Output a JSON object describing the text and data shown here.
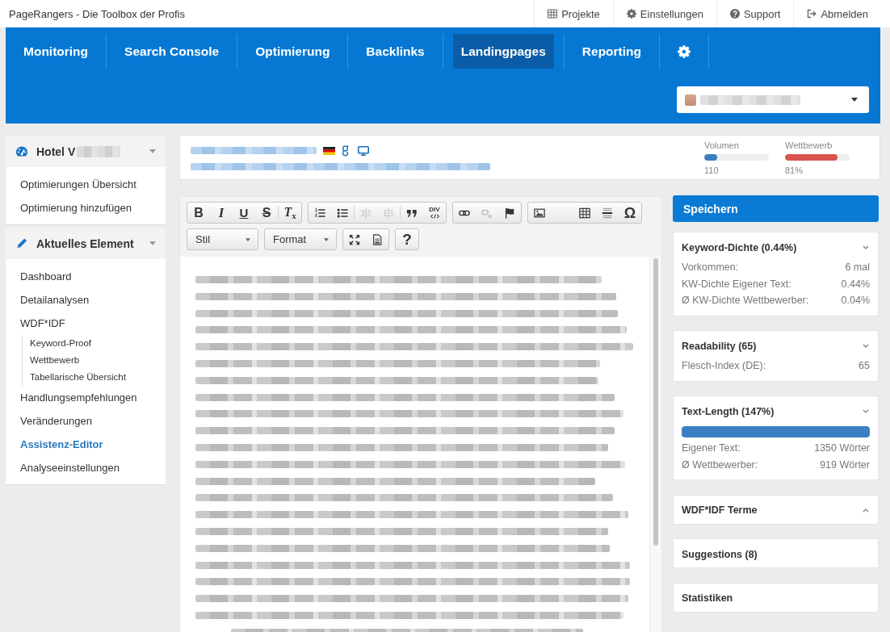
{
  "app": {
    "title": "PageRangers - Die Toolbox der Profis"
  },
  "top_links": [
    {
      "label": "Projekte"
    },
    {
      "label": "Einstellungen"
    },
    {
      "label": "Support"
    },
    {
      "label": "Abmelden"
    }
  ],
  "main_nav": {
    "tabs": [
      {
        "label": "Monitoring",
        "selected": false
      },
      {
        "label": "Search Console",
        "selected": false
      },
      {
        "label": "Optimierung",
        "selected": false
      },
      {
        "label": "Backlinks",
        "selected": false
      },
      {
        "label": "Landingpages",
        "selected": true
      },
      {
        "label": "Reporting",
        "selected": false
      }
    ],
    "settings_tab": {
      "selected": false
    }
  },
  "sidebar": {
    "panels": [
      {
        "title": "Hotel V",
        "items": [
          {
            "label": "Optimierungen Übersicht",
            "selected": false
          },
          {
            "label": "Optimierung hinzufügen",
            "selected": false
          }
        ]
      },
      {
        "title": "Aktuelles Element",
        "items": [
          {
            "label": "Dashboard",
            "selected": false
          },
          {
            "label": "Detailanalysen",
            "selected": false
          },
          {
            "label": "WDF*IDF",
            "selected": false,
            "children": [
              {
                "label": "Keyword-Proof",
                "selected": false
              },
              {
                "label": "Wettbewerb",
                "selected": false
              },
              {
                "label": "Tabellarische Übersicht",
                "selected": false
              }
            ]
          },
          {
            "label": "Handlungsempfehlungen",
            "selected": false
          },
          {
            "label": "Veränderungen",
            "selected": false
          },
          {
            "label": "Assistenz-Editor",
            "selected": true
          },
          {
            "label": "Analyseeinstellungen",
            "selected": false
          }
        ]
      }
    ]
  },
  "keyword": {
    "metrics": [
      {
        "label": "Volumen",
        "level": 0.2,
        "value": "110",
        "color": "#3a7fc1"
      },
      {
        "label": "Wettbewerb",
        "level": 0.81,
        "value": "81%",
        "color": "#d9534f"
      }
    ]
  },
  "editor": {
    "toolbar": {
      "lines": [
        {
          "groups": [
            {
              "kind": "buttons",
              "buttons": [
                {
                  "kind": "glyph",
                  "label": "B",
                  "disabled": false
                },
                {
                  "kind": "glyph",
                  "label": "I",
                  "disabled": false
                },
                {
                  "kind": "glyph",
                  "label": "U",
                  "disabled": false
                },
                {
                  "kind": "glyph",
                  "label": "S",
                  "disabled": false
                },
                {
                  "kind": "glyph",
                  "label": "T$_{x}$",
                  "disabled": false
                }
              ]
            },
            {
              "kind": "buttons",
              "buttons": [
                {
                  "kind": "icon",
                  "disabled": false
                },
                {
                  "kind": "icon",
                  "disabled": false
                },
                {
                  "kind": "icon",
                  "disabled": true
                },
                {
                  "kind": "icon",
                  "disabled": true
                },
                {
                  "kind": "icon",
                  "disabled": false
                },
                {
                  "kind": "code",
                  "label": "DIV",
                  "disabled": false
                }
              ]
            },
            {
              "kind": "buttons",
              "buttons": [
                {
                  "kind": "icon",
                  "disabled": false
                },
                {
                  "kind": "icon",
                  "disabled": true
                },
                {
                  "kind": "icon",
                  "disabled": false
                }
              ]
            },
            {
              "kind": "buttons",
              "buttons": [
                {
                  "kind": "icon",
                  "disabled": false
                },
                {
                  "kind": "icon",
                  "disabled": false
                },
                {
                  "kind": "icon",
                  "disabled": false
                },
                {
                  "kind": "glyph",
                  "label": "Ω",
                  "disabled": false
                }
              ]
            }
          ]
        },
        {
          "groups": [
            {
              "kind": "dropdown",
              "label": "Stil"
            },
            {
              "kind": "dropdown",
              "label": "Format"
            },
            {
              "kind": "buttons",
              "buttons": [
                {
                  "kind": "icon",
                  "disabled": false
                },
                {
                  "kind": "icon",
                  "disabled": false
                }
              ]
            },
            {
              "kind": "buttons",
              "buttons": [
                {
                  "kind": "glyph",
                  "label": "?",
                  "disabled": false
                }
              ]
            }
          ]
        }
      ]
    }
  },
  "side_panel": {
    "save_button": "Speichern",
    "cards": [
      {
        "title": "Keyword-Dichte (0.44%)",
        "expanded": true,
        "rows": [
          {
            "label": "Vorkommen:",
            "value": "6 mal"
          },
          {
            "label": "KW-Dichte Eigener Text:",
            "value": "0.44%"
          },
          {
            "label": "Ø KW-Dichte Wettbewerber:",
            "value": "0.04%"
          }
        ]
      },
      {
        "title": "Readability (65)",
        "expanded": true,
        "rows": [
          {
            "label": "Flesch-Index (DE):",
            "value": "65"
          }
        ]
      },
      {
        "title": "Text-Length (147%)",
        "expanded": true,
        "level": 1,
        "rows": [
          {
            "label": "Eigener Text:",
            "value": "1350 Wörter"
          },
          {
            "label": "Ø Wettbewerber:",
            "value": "919 Wörter"
          }
        ]
      },
      {
        "title": "WDF*IDF Terme",
        "expanded": false
      },
      {
        "title": "Suggestions (8)"
      },
      {
        "title": "Statistiken"
      }
    ]
  }
}
